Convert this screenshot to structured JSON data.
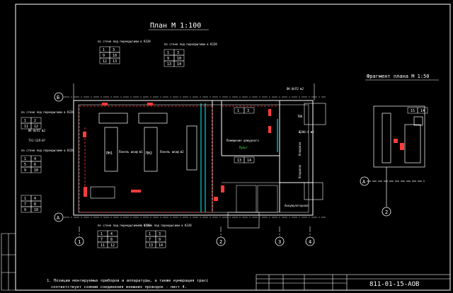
{
  "title": "План  М 1:100",
  "fragment_title": "Фрагмент плана М 1:50",
  "stamp_code": "811-01-15-АОВ",
  "note": "1. Позиции монтируемых приборов и аппаратуры, а также нумерация трасс",
  "note2": "соответствует схемам соединения внешних проводок - лист 4.",
  "axes": {
    "a": "А",
    "b": "Б",
    "n1": "1",
    "n2": "2",
    "n3": "3",
    "n4": "4"
  },
  "header_notes": {
    "left": "по стене под\nперекрытием в К328",
    "right": "по стене под\nперекрытием в К328",
    "mid_left": "по стене под\nперекрытием в К328",
    "left2": "по стене под\nперекрытием в К328",
    "bottom1": "по стене под\nперекрытием в К328",
    "bottom2": "по стене под\nперекрытием в К328"
  },
  "tables": {
    "top_left": [
      [
        "1",
        "3"
      ],
      [
        "9",
        "10"
      ],
      [
        "12",
        "13"
      ]
    ],
    "top_right": [
      [
        "1",
        "3"
      ],
      [
        "9",
        "10"
      ],
      [
        "13",
        "14"
      ]
    ],
    "left_a": [
      [
        "1",
        "2"
      ],
      [
        "11",
        "12"
      ]
    ],
    "left_b": [
      [
        "1",
        "4"
      ],
      [
        "5",
        "6"
      ],
      [
        "9",
        "10"
      ]
    ],
    "left_c": [
      [
        "1",
        "4"
      ],
      [
        "7",
        "8"
      ],
      [
        "9",
        "10"
      ]
    ],
    "bottom_a": [
      [
        "1",
        "4"
      ],
      [
        "7",
        "8"
      ],
      [
        "11",
        "12"
      ]
    ],
    "bottom_b": [
      [
        "1",
        "3"
      ],
      [
        "7",
        "9"
      ],
      [
        "13",
        "14"
      ]
    ],
    "room_right": [
      [
        "1",
        "3"
      ]
    ],
    "room_small": [
      [
        "13",
        "14"
      ]
    ],
    "frag_table": [
      [
        "15",
        "14"
      ]
    ]
  },
  "room_labels": {
    "pump1": "ПН1",
    "pump2": "ПН2",
    "panel1": "Панель\nшкаф №1",
    "panel2": "Панель\nшкаф №2",
    "office": "Помещение\nдежурного",
    "kladovaya": "Кладовая",
    "kladovaya2": "Кладовая",
    "accum": "Аккумуляторная",
    "tvk": "ТВК",
    "corridor": "Коридор",
    "pulpit": "Пульт"
  },
  "tags": {
    "vp1": "ВК-Ш/Л2 №2",
    "vp2": "ВК-Ш/Л2 №2",
    "dev1": "Щ200-4 №2",
    "dev2": "Щ200-4 №2",
    "cable1": "ТЭ1-1ЗЛ-8?",
    "cable2": "ТЭ1-1ЗЛ-8?"
  },
  "colors": {
    "line": "#ffffff",
    "accent": "#ff3b3b",
    "cyan": "#00ffff",
    "yellow": "#ffff55",
    "green": "#55ff55"
  }
}
